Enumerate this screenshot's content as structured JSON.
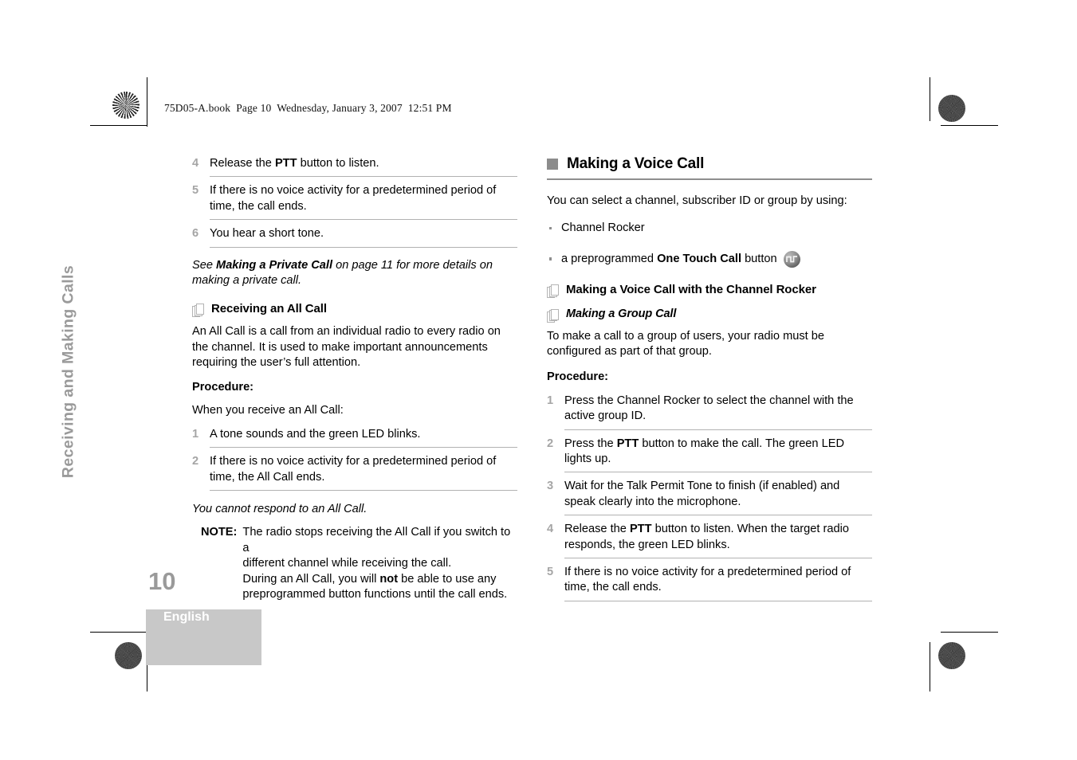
{
  "print_slug": "75D05-A.book  Page 10  Wednesday, January 3, 2007  12:51 PM",
  "side_tab": "Receiving and Making Calls",
  "footer": {
    "page_number": "10",
    "language": "English"
  },
  "left_column": {
    "continued_steps": [
      {
        "num": "4",
        "html": "Release the <b>PTT</b> button to listen."
      },
      {
        "num": "5",
        "html": "If there is no voice activity for a predetermined period of time, the call ends."
      },
      {
        "num": "6",
        "html": "You hear a short tone."
      }
    ],
    "cross_reference": "See Making a Private Call on page 11 for more details on making a private call.",
    "cross_reference_html": "See <b>Making a Private Call</b> on page 11 for more details on making a private call.",
    "section": {
      "icon": "page-stack-icon",
      "heading": "Receiving an All Call",
      "intro": "An All Call is a call from an individual radio to every radio on the channel. It is used to make important announcements requiring the user’s full attention.",
      "procedure_label": "Procedure:",
      "procedure_lead": "When you receive an All Call:",
      "steps": [
        {
          "num": "1",
          "html": "A tone sounds and the green LED blinks."
        },
        {
          "num": "2",
          "html": "If there is no voice activity for a predetermined period of time, the All Call ends."
        }
      ],
      "after_note": "You cannot respond to an All Call.",
      "note": {
        "label": "NOTE:",
        "lines": [
          "The radio stops receiving the All Call if you switch to a",
          "different channel while receiving the call.",
          "During an All Call, you will <b>not</b> be able to use any",
          "preprogrammed button functions until the call ends."
        ]
      }
    }
  },
  "right_column": {
    "chapter": {
      "bullet": "square-bullet-icon",
      "title": "Making a Voice Call"
    },
    "intro": "You can select a channel, subscriber ID or group by using:",
    "bullets": [
      {
        "html": "Channel Rocker",
        "icon": null
      },
      {
        "html": "a preprogrammed <b>One Touch Call</b> button",
        "icon": "one-touch-call-button-icon"
      }
    ],
    "section": {
      "icon": "page-stack-icon",
      "heading": "Making a Voice Call with the Channel Rocker",
      "sub_icon": "page-stack-icon",
      "sub_heading": "Making a Group Call",
      "intro": "To make a call to a group of users, your radio must be configured as part of that group.",
      "procedure_label": "Procedure:",
      "steps": [
        {
          "num": "1",
          "html": "Press the Channel Rocker to select the channel with the active group ID."
        },
        {
          "num": "2",
          "html": "Press the <b>PTT</b> button to make the call. The green LED lights up."
        },
        {
          "num": "3",
          "html": "Wait for the Talk Permit Tone to finish (if enabled) and speak clearly into the microphone."
        },
        {
          "num": "4",
          "html": "Release the <b>PTT</b> button to listen. When the target radio responds, the green LED blinks."
        },
        {
          "num": "5",
          "html": "If there is no voice activity for a predetermined period of time, the call ends."
        }
      ]
    }
  },
  "colors": {
    "accent_gray": "#8e8e8e",
    "number_gray": "#a5a5a5",
    "tab_gray": "#9a9a9a",
    "lang_block": "#c8c8c8",
    "rule_gray": "#b2b2b2"
  }
}
